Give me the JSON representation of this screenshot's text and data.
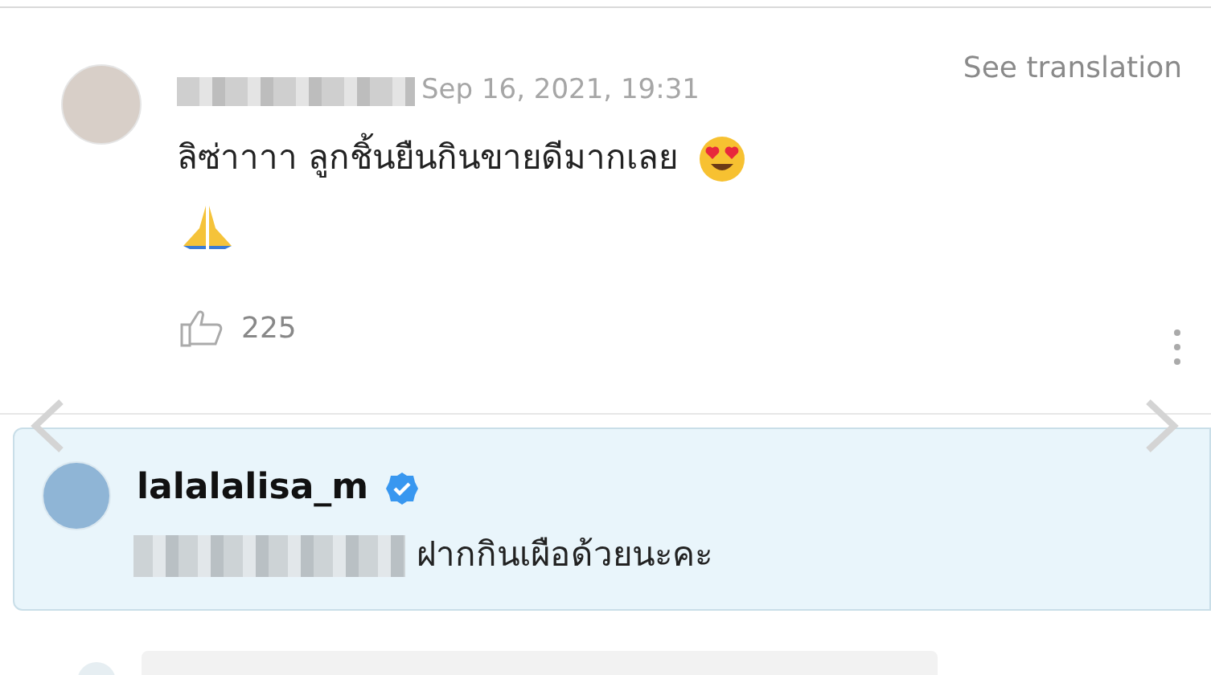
{
  "comment": {
    "date": "Sep 16, 2021, 19:31",
    "translate_link": "See translation",
    "text": "ลิซ่าาาา ลูกชิ้นยืนกินขายดีมากเลย",
    "likes": "225"
  },
  "reply": {
    "username": "lalalalisa_m",
    "verified": true,
    "text": "ฝากกินเผือด้วยนะคะ"
  }
}
